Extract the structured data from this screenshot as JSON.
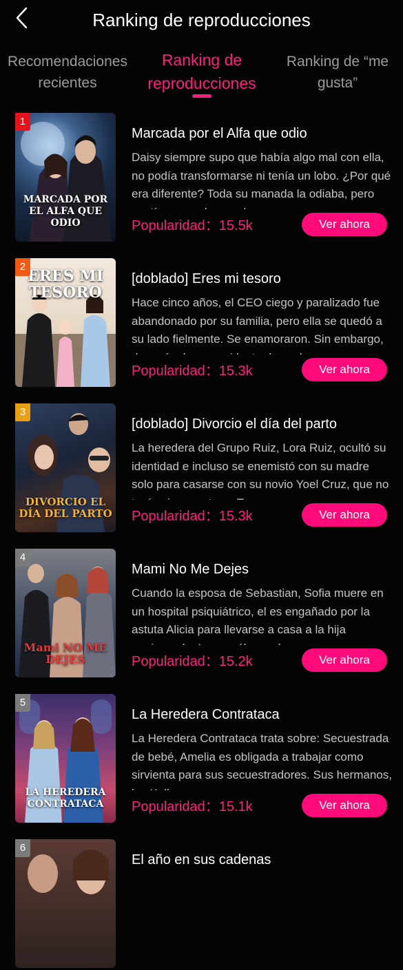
{
  "header": {
    "title": "Ranking de reproducciones",
    "back_icon": "chevron-left-icon"
  },
  "tabs": [
    {
      "line1": "Recomendaciones",
      "line2": "recientes",
      "active": false
    },
    {
      "line1": "Ranking de",
      "line2": "reproducciones",
      "active": true
    },
    {
      "line1": "Ranking de  “me",
      "line2": "gusta”",
      "active": false
    }
  ],
  "colors": {
    "accent": "#ff1f80",
    "button": "#ff0a7a",
    "background": "#050505"
  },
  "items": [
    {
      "rank": "1",
      "title": "Marcada por el Alfa que odio",
      "description": "Daisy siempre supo que había algo mal con ella, no podía transformarse ni tenía un lobo. ¿Por qué era diferente? Toda su manada la odiaba, pero sentía consuelo por al menos",
      "popularity": "Popularidad：15.5k",
      "button": "Ver ahora",
      "poster_text": "MARCADA POR EL ALFA QUE ODIO"
    },
    {
      "rank": "2",
      "title": "[doblado] Eres mi tesoro",
      "description": "Hace cinco años, el CEO ciego y paralizado fue abandonado por su familia, pero ella se quedó a su lado fielmente. Se enamoraron. Sin embargo, después de un accidente de coche",
      "popularity": "Popularidad：15.3k",
      "button": "Ver ahora",
      "poster_text": "ERES MI TESORO"
    },
    {
      "rank": "3",
      "title": "[doblado] Divorcio el día del parto",
      "description": "La heredera del Grupo Ruiz, Lora Ruiz, ocultó su identidad e incluso se enemistó con su madre solo para casarse con su novio Yoel Cruz, que no tenía ni un centavo. Tras nueve",
      "popularity": "Popularidad：15.3k",
      "button": "Ver ahora",
      "poster_text": "DIVORCIO EL DÍA DEL PARTO"
    },
    {
      "rank": "4",
      "title": "Mami No Me Dejes",
      "description": "Cuando la esposa de Sebastian, Sofia muere en un hospital psiquiátrico, el es engañado por la astuta Alicia para llevarse a casa a la hija equivocada. Lo que él no sabe es que su",
      "popularity": "Popularidad：15.2k",
      "button": "Ver ahora",
      "poster_text": "Mami NO ME DEJES"
    },
    {
      "rank": "5",
      "title": "La Heredera Contrataca",
      "description": "La Heredera Contrataca trata sobre: Secuestrada de bebé, Amelia es obligada a trabajar como sirvienta para sus secuestradores. Sus hermanos, los Keller",
      "popularity": "Popularidad：15.1k",
      "button": "Ver ahora",
      "poster_text": "LA HEREDERA CONTRATACA"
    },
    {
      "rank": "6",
      "title": "El año en sus cadenas",
      "description": "",
      "popularity": "",
      "button": "",
      "poster_text": ""
    }
  ]
}
